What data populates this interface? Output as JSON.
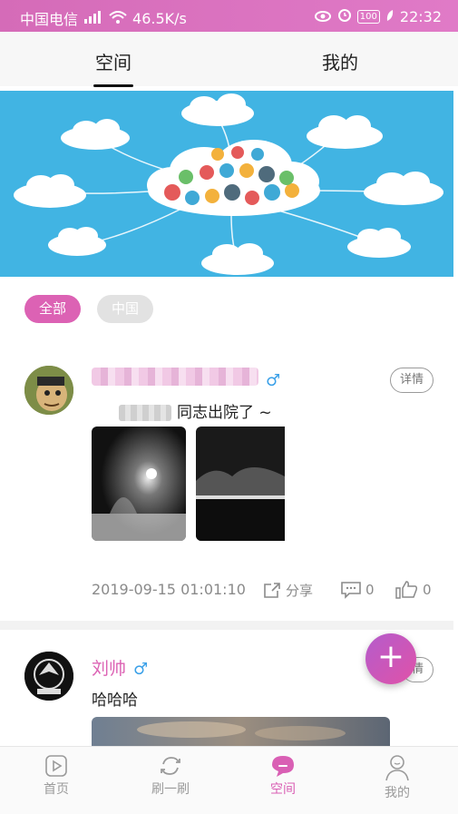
{
  "status": {
    "carrier": "中国电信",
    "net": "46.5K/s",
    "battery": "100",
    "time": "22:32"
  },
  "top_tabs": [
    {
      "label": "空间",
      "active": true
    },
    {
      "label": "我的",
      "active": false
    }
  ],
  "filters": [
    {
      "label": "全部",
      "active": true
    },
    {
      "label": "中国",
      "active": false
    }
  ],
  "posts": [
    {
      "user_name": "",
      "gender": "♂",
      "detail_label": "详情",
      "content": "同志出院了 ~",
      "time": "2019-09-15 01:01:10",
      "share_label": "分享",
      "comments": "0",
      "likes": "0"
    },
    {
      "user_name": "刘帅",
      "gender": "♂",
      "detail_label": "情",
      "content": "哈哈哈"
    }
  ],
  "fab_label": "+",
  "bottom_nav": [
    {
      "label": "首页",
      "icon": "play-icon"
    },
    {
      "label": "刷一刷",
      "icon": "refresh-icon"
    },
    {
      "label": "空间",
      "icon": "chat-bubble-icon",
      "active": true
    },
    {
      "label": "我的",
      "icon": "user-icon"
    }
  ],
  "colors": {
    "accent": "#dc62b4",
    "status_bar": "#d56bb8",
    "male_icon": "#3aa0e8",
    "banner_bg": "#41b4e3"
  }
}
